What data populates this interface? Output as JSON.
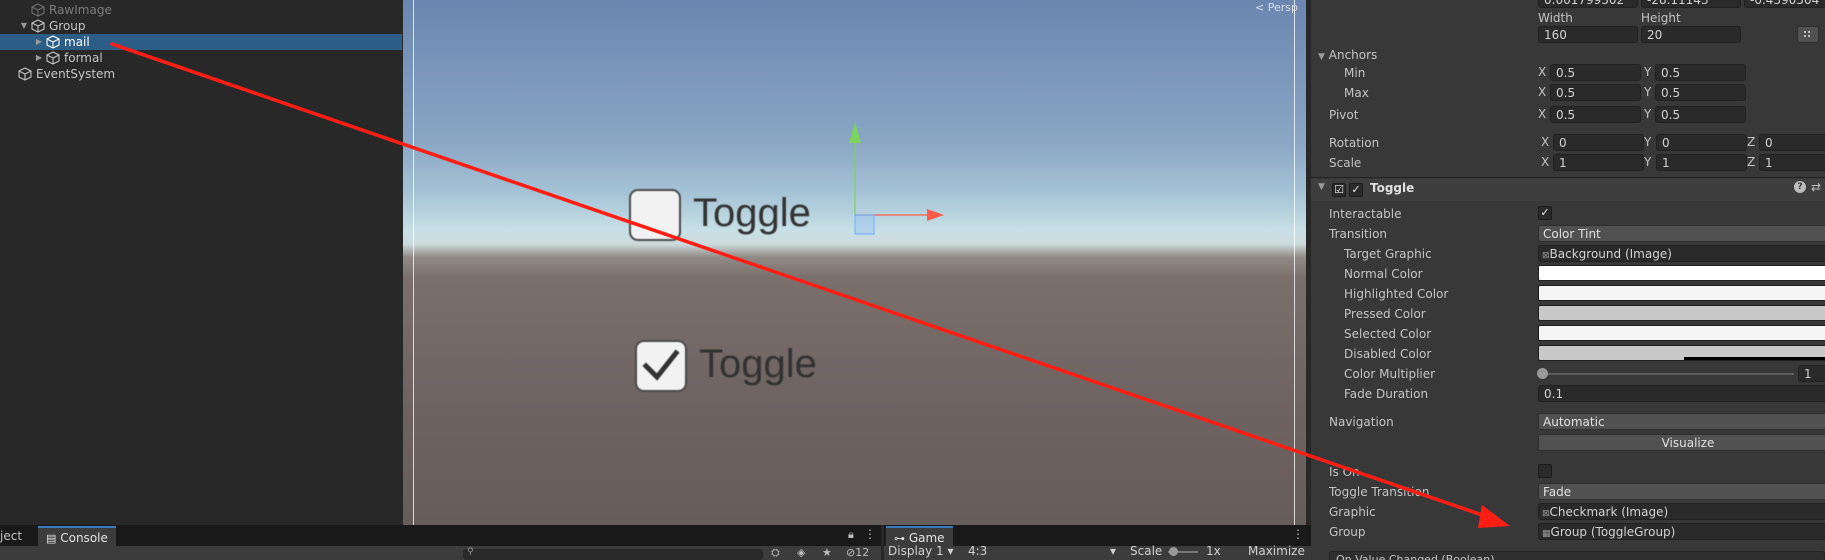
{
  "hierarchy": {
    "items": [
      {
        "label": "RawImage",
        "fold": "",
        "dim": true
      },
      {
        "label": "Group",
        "fold": "▼"
      },
      {
        "label": "mail",
        "fold": "▶",
        "selected": true
      },
      {
        "label": "formal",
        "fold": "▶"
      },
      {
        "label": "EventSystem",
        "fold": ""
      }
    ]
  },
  "scene": {
    "camera_label": "Persp",
    "toggles": [
      {
        "label": "Toggle",
        "checked": false
      },
      {
        "label": "Toggle",
        "checked": true
      }
    ]
  },
  "inspector": {
    "top_values": [
      "0.001799302",
      "-28.11143",
      "-0.4390504"
    ],
    "width_label": "Width",
    "height_label": "Height",
    "width_value": "160",
    "height_value": "20",
    "anchors_label": "Anchors",
    "min_label": "Min",
    "max_label": "Max",
    "pivot_label": "Pivot",
    "rotation_label": "Rotation",
    "scale_label": "Scale",
    "axis_x": "X",
    "axis_y": "Y",
    "axis_z": "Z",
    "anchor_min": {
      "x": "0.5",
      "y": "0.5"
    },
    "anchor_max": {
      "x": "0.5",
      "y": "0.5"
    },
    "pivot": {
      "x": "0.5",
      "y": "0.5"
    },
    "rotation": {
      "x": "0",
      "y": "0",
      "z": "0"
    },
    "scale": {
      "x": "1",
      "y": "1",
      "z": "1"
    },
    "component_title": "Toggle",
    "component_enabled": true,
    "interactable_label": "Interactable",
    "interactable_checked": true,
    "transition_label": "Transition",
    "transition_value": "Color Tint",
    "target_graphic_label": "Target Graphic",
    "target_graphic_value": "Background (Image)",
    "normal_color_label": "Normal Color",
    "highlighted_color_label": "Highlighted Color",
    "pressed_color_label": "Pressed Color",
    "selected_color_label": "Selected Color",
    "disabled_color_label": "Disabled Color",
    "colors": {
      "normal": "#ffffff",
      "highlighted": "#f5f5f5",
      "pressed": "#c8c8c8",
      "selected": "#f5f5f5",
      "disabled": "#c8c8c8"
    },
    "color_multiplier_label": "Color Multiplier",
    "color_multiplier_value": "1",
    "color_multiplier_fraction": 0.0,
    "fade_duration_label": "Fade Duration",
    "fade_duration_value": "0.1",
    "navigation_label": "Navigation",
    "navigation_value": "Automatic",
    "visualize_label": "Visualize",
    "is_on_label": "Is On",
    "toggle_transition_label": "Toggle Transition",
    "toggle_transition_value": "Fade",
    "graphic_label": "Graphic",
    "graphic_value": "Checkmark (Image)",
    "group_label": "Group",
    "group_value": "Group (ToggleGroup)",
    "on_value_changed_label": "On Value Changed (Boolean)"
  },
  "bottom": {
    "project_tab": "ject",
    "console_tab": "Console",
    "hidden_count": "12",
    "game_tab": "Game",
    "display_value": "Display 1",
    "aspect_value": "4:3",
    "scale_label": "Scale",
    "scale_value": "1x",
    "maximize_label": "Maximize"
  },
  "annotation": {
    "color": "#ff1e14"
  }
}
